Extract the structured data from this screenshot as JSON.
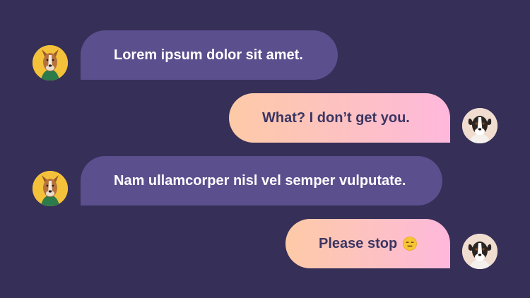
{
  "messages": [
    {
      "sender": "left-dog",
      "text": "Lorem ipsum dolor sit amet."
    },
    {
      "sender": "right-dog",
      "text": "What? I don’t get you."
    },
    {
      "sender": "left-dog",
      "text": "Nam ullamcorper nisl vel semper vulputate."
    },
    {
      "sender": "right-dog",
      "text": "Please stop",
      "emoji": "expressionless-face-icon"
    }
  ],
  "colors": {
    "background": "#362f57",
    "incoming_bubble": "#5b4f8e",
    "outgoing_gradient_start": "#fdcaa7",
    "outgoing_gradient_end": "#ffb8dc",
    "outgoing_text": "#3b3563",
    "incoming_text": "#ffffff"
  }
}
